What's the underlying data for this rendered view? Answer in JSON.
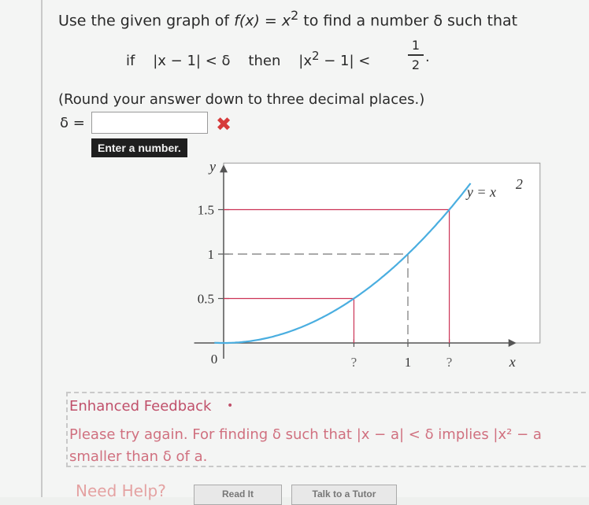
{
  "question": {
    "prompt_prefix": "Use the given graph of ",
    "function": "f(x) = x",
    "exp": "2",
    "prompt_suffix": " to find a number δ such that",
    "cond_if": "if",
    "cond_lhs": "|x − 1| < δ",
    "cond_then": "then",
    "cond_rhs_a": "|x",
    "cond_rhs_exp": "2",
    "cond_rhs_b": " − 1| <",
    "frac_num": "1",
    "frac_den": "2",
    "frac_tail": ".",
    "round_note": "(Round your answer down to three decimal places.)"
  },
  "answer": {
    "label": "δ =",
    "value": "",
    "tooltip": "Enter a number."
  },
  "icons": {
    "wrong": "✖"
  },
  "chart_data": {
    "type": "line",
    "series": [
      {
        "name": "y = x²",
        "function": "x^2",
        "x": [
          0,
          0.2,
          0.4,
          0.6,
          0.707,
          0.8,
          1.0,
          1.1,
          1.2247,
          1.35
        ],
        "y": [
          0,
          0.04,
          0.16,
          0.36,
          0.5,
          0.64,
          1.0,
          1.21,
          1.5,
          1.8225
        ]
      }
    ],
    "xlabel": "x",
    "ylabel": "y",
    "curve_label": "y = x",
    "curve_label_exp": "2",
    "y_ticks": [
      "1.5",
      "1",
      "0.5"
    ],
    "origin_label": "0",
    "x_ticks": [
      "?",
      "1",
      "?"
    ],
    "xlim": [
      -0.4,
      1.7
    ],
    "ylim": [
      0,
      1.9
    ],
    "guides": [
      {
        "y": 1.5,
        "x": 1.2247,
        "color": "#cc3355",
        "style": "solid"
      },
      {
        "y": 1.0,
        "x": 1.0,
        "color": "#777777",
        "style": "dashed"
      },
      {
        "y": 0.5,
        "x": 0.707,
        "color": "#cc3355",
        "style": "solid"
      }
    ],
    "curve_color": "#4aaee0"
  },
  "feedback": {
    "title": "Enhanced Feedback",
    "dot": "•",
    "line1": "Please try again. For finding δ such that |x − a| < δ implies |x² − a",
    "line2": "smaller than δ of a."
  },
  "help": {
    "label": "Need Help?",
    "read_it": "Read It",
    "talk": "Talk to a Tutor"
  }
}
